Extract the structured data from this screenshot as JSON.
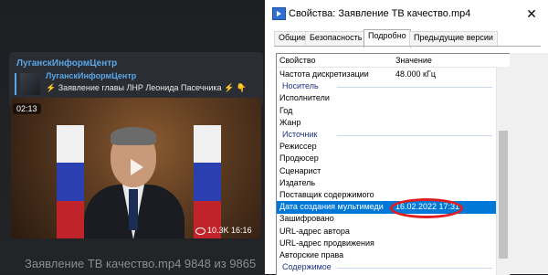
{
  "telegram": {
    "channel_name": "ЛуганскИнформЦентр",
    "reply_name": "ЛуганскИнформЦентр",
    "reply_text": "⚡ Заявление главы ЛНР Леонида Пасечника ⚡ 👇",
    "video_duration": "02:13",
    "views": "10.3K",
    "post_time": "16:16",
    "caption": "Заявление ТВ качество.mp4 9848 из 9865"
  },
  "dialog": {
    "title": "Свойства: Заявление ТВ качество.mp4",
    "close_label": "✕",
    "tabs": [
      {
        "label": "Общие",
        "active": false
      },
      {
        "label": "Безопасность",
        "active": false
      },
      {
        "label": "Подробно",
        "active": true
      },
      {
        "label": "Предыдущие версии",
        "active": false
      }
    ],
    "columns": {
      "property": "Свойство",
      "value": "Значение"
    },
    "rows": [
      {
        "key": "Частота дискретизации",
        "value": "48.000 кГц"
      },
      {
        "key": "Носитель",
        "group": true
      },
      {
        "key": "Исполнители"
      },
      {
        "key": "Год"
      },
      {
        "key": "Жанр"
      },
      {
        "key": "Источник",
        "group": true
      },
      {
        "key": "Режиссер"
      },
      {
        "key": "Продюсер"
      },
      {
        "key": "Сценарист"
      },
      {
        "key": "Издатель"
      },
      {
        "key": "Поставщик содержимого"
      },
      {
        "key": "Дата создания мультимеди",
        "value": "16.02.2022 17:31",
        "selected": true
      },
      {
        "key": "Зашифровано"
      },
      {
        "key": "URL-адрес автора"
      },
      {
        "key": "URL-адрес продвижения"
      },
      {
        "key": "Авторские права"
      },
      {
        "key": "Содержимое",
        "group": true
      }
    ]
  },
  "colors": {
    "selection": "#0078d7",
    "highlight": "#e11d1d",
    "link": "#5aa6e6"
  }
}
